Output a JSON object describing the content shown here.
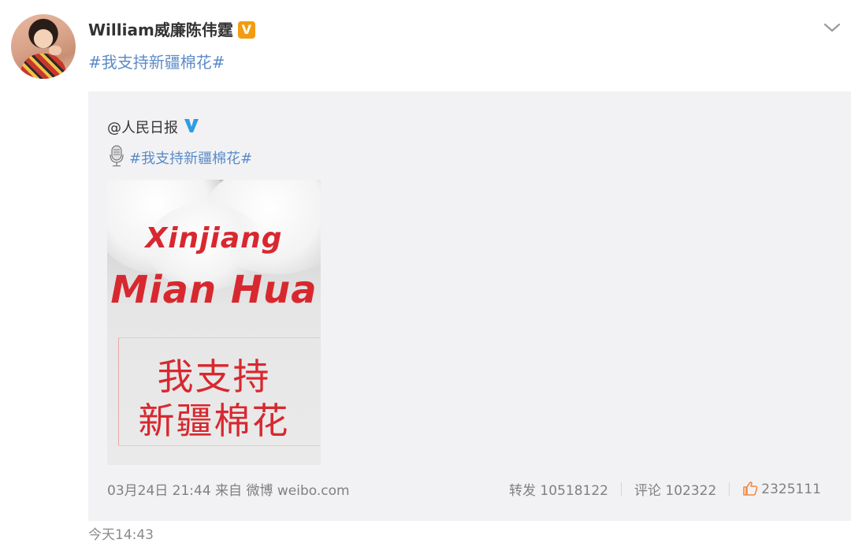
{
  "post": {
    "username": "William威廉陈伟霆",
    "hashtag": "#我支持新疆棉花#",
    "time": "今天14:43"
  },
  "repost": {
    "username": "@人民日报",
    "hashtag": "#我支持新疆棉花#",
    "image": {
      "title_line1": "Xinjiang",
      "title_line2": "Mian Hua",
      "cn_line1": "我支持",
      "cn_line2": "新疆棉花"
    },
    "meta": "03月24日 21:44 来自 微博 weibo.com",
    "stats": {
      "repost": "转发 10518122",
      "comment": "评论 102322",
      "like": "2325111"
    }
  },
  "colors": {
    "link": "#5b8bc7",
    "accent_red": "#d8282f",
    "badge_orange": "#f39c12",
    "badge_blue": "#2d9ee0",
    "repost_bg": "#f2f2f5"
  },
  "icons": [
    "avatar",
    "verified-orange-icon",
    "chevron-down-icon",
    "verified-blue-icon",
    "microphone-icon",
    "like-icon"
  ]
}
